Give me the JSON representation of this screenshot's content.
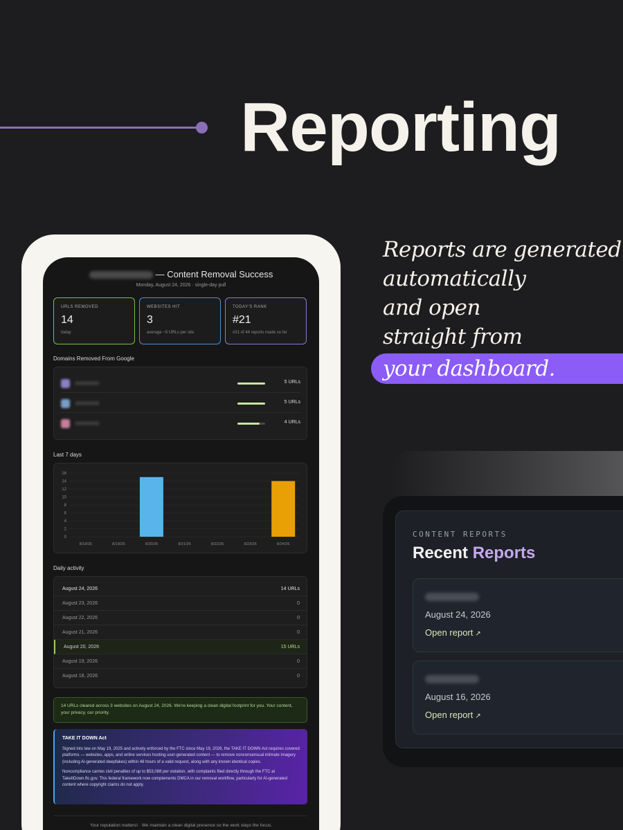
{
  "header": {
    "title": "Reporting"
  },
  "tagline": {
    "lines": [
      "Reports are generated",
      "automatically",
      "and open",
      "straight from"
    ],
    "highlight": "your dashboard."
  },
  "report": {
    "title": "— Content Removal Success",
    "subtitle": "Monday, August 24, 2026 · single-day pull",
    "stats": [
      {
        "label": "URLS REMOVED",
        "value": "14",
        "note": "today",
        "color": "#7bbf4a"
      },
      {
        "label": "WEBSITES HIT",
        "value": "3",
        "note": "average ~5 URLs per site",
        "color": "#4d8fd1"
      },
      {
        "label": "TODAY'S RANK",
        "value": "#21",
        "note": "#21 of 44 reports made so far",
        "color": "#8b7ad8"
      }
    ],
    "domains_heading": "Domains Removed From Google",
    "domains": [
      {
        "count_label": "5 URLs",
        "fill": 1.0,
        "icon_color": "#8a7fc8"
      },
      {
        "count_label": "5 URLs",
        "fill": 1.0,
        "icon_color": "#7a9cc8"
      },
      {
        "count_label": "4 URLs",
        "fill": 0.8,
        "icon_color": "#c87f9a"
      }
    ],
    "chart_heading": "Last 7 days",
    "activity_heading": "Daily activity",
    "activity": [
      {
        "date": "August 24, 2026",
        "value": "14 URLs",
        "style": "bold"
      },
      {
        "date": "August 23, 2026",
        "value": "0",
        "style": ""
      },
      {
        "date": "August 22, 2026",
        "value": "0",
        "style": ""
      },
      {
        "date": "August 21, 2026",
        "value": "0",
        "style": ""
      },
      {
        "date": "August 20, 2026",
        "value": "15 URLs",
        "style": "hl"
      },
      {
        "date": "August 19, 2026",
        "value": "0",
        "style": ""
      },
      {
        "date": "August 18, 2026",
        "value": "0",
        "style": ""
      }
    ],
    "summary": "14 URLs cleared across 3 websites on August 24, 2026. We're keeping a clean digital footprint for you. Your content, your privacy, our priority.",
    "law": {
      "title": "TAKE IT DOWN Act",
      "p1": "Signed into law on May 19, 2025 and actively enforced by the FTC since May 19, 2026, the TAKE IT DOWN Act requires covered platforms — websites, apps, and online services hosting user-generated content — to remove nonconsensual intimate imagery (including AI-generated deepfakes) within 48 hours of a valid request, along with any known identical copies.",
      "p2": "Noncompliance carries civil penalties of up to $53,088 per violation, with complaints filed directly through the FTC at TakeItDown.ftc.gov. This federal framework now complements DMCA in our removal workflow, particularly for AI-generated content where copyright claims do not apply."
    },
    "footer": "Your reputation matters! · We maintain a clean digital presence so the work stays the focus."
  },
  "chart_data": {
    "type": "bar",
    "categories": [
      "8/18/26",
      "8/19/26",
      "8/20/26",
      "8/21/26",
      "8/22/26",
      "8/23/26",
      "8/24/26"
    ],
    "values": [
      0,
      0,
      15,
      0,
      0,
      0,
      14
    ],
    "colors": [
      "#5ab4ec",
      "#5ab4ec",
      "#5ab4ec",
      "#5ab4ec",
      "#5ab4ec",
      "#5ab4ec",
      "#e8a005"
    ],
    "ylim": [
      0,
      16
    ],
    "yticks": [
      0,
      2,
      4,
      6,
      8,
      10,
      12,
      14,
      16
    ],
    "grid": true,
    "title": "",
    "xlabel": "",
    "ylabel": ""
  },
  "panel": {
    "eyebrow": "CONTENT REPORTS",
    "title_plain": "Recent",
    "title_accent": "Reports",
    "reports": [
      {
        "date": "August 24, 2026",
        "link": "Open report"
      },
      {
        "date": "August 16, 2026",
        "link": "Open report"
      }
    ]
  }
}
